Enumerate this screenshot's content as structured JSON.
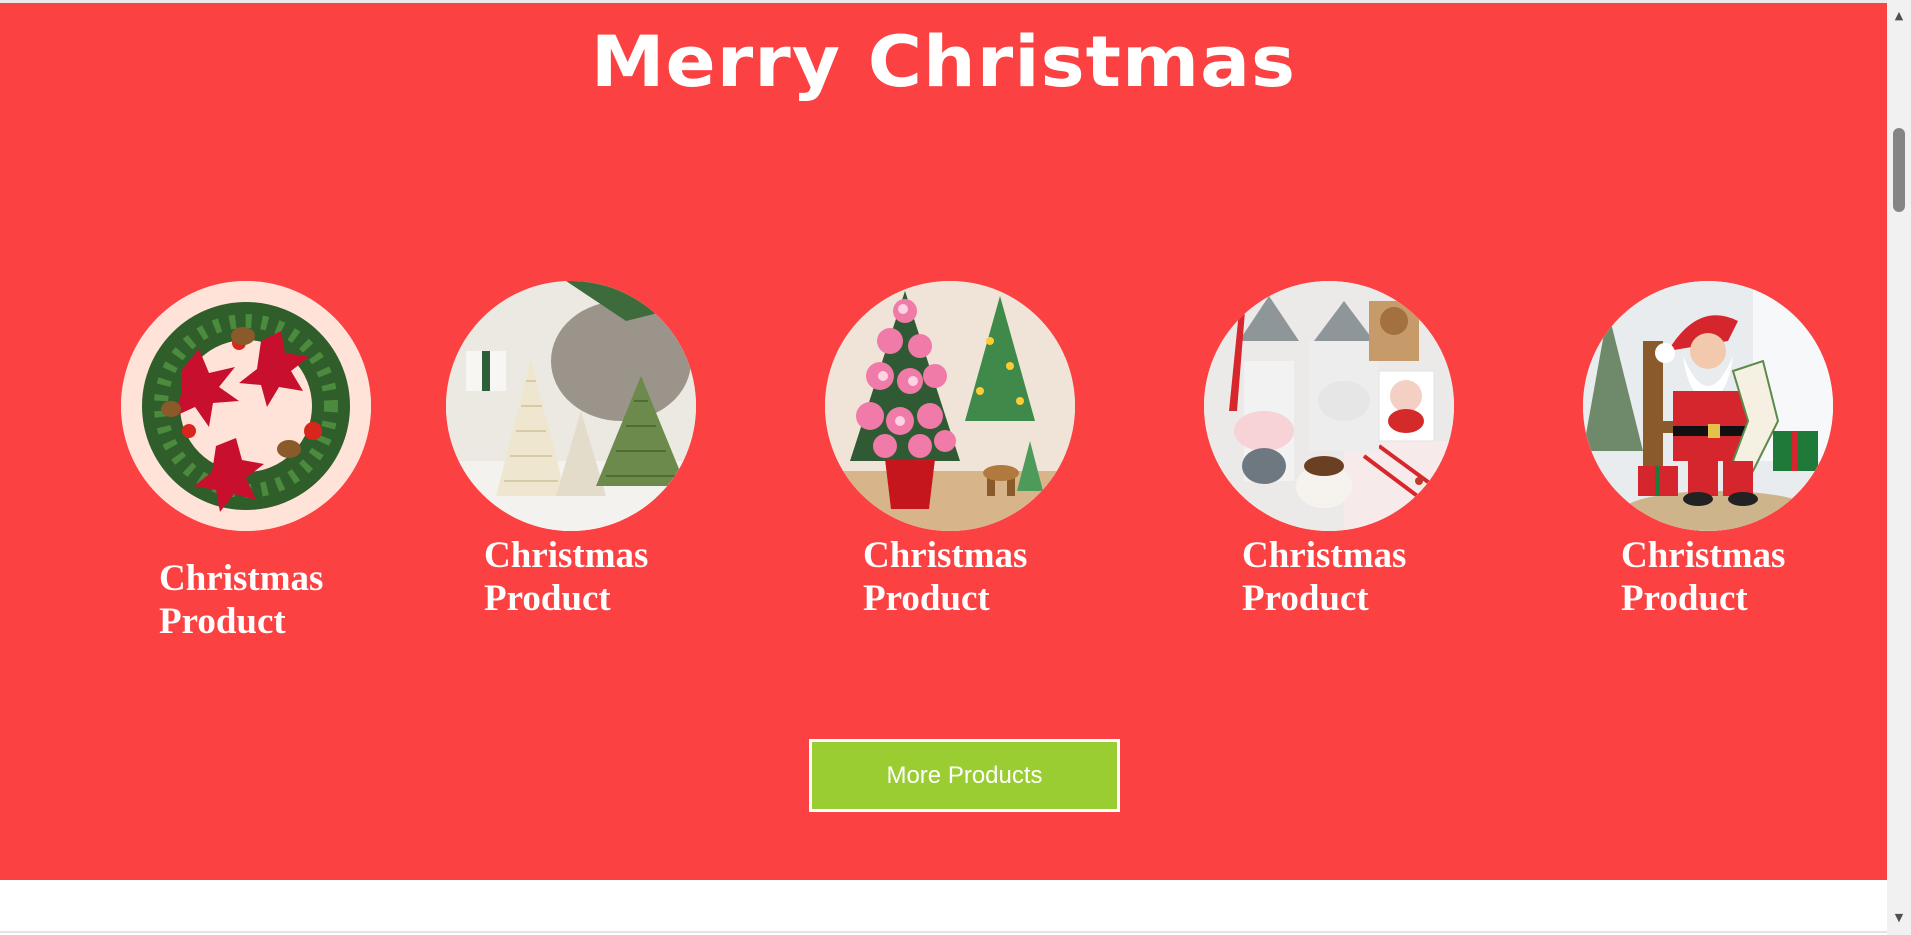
{
  "page": {
    "title": "Merry Christmas",
    "colors": {
      "banner": "#fb4141",
      "button": "#9acd32",
      "text": "#ffffff"
    }
  },
  "products": [
    {
      "label": "Christmas Product",
      "image": "poinsettia-wreath"
    },
    {
      "label": "Christmas Product",
      "image": "paper-honeycomb-trees"
    },
    {
      "label": "Christmas Product",
      "image": "pink-flower-tree"
    },
    {
      "label": "Christmas Product",
      "image": "gnome-santa-mugs"
    },
    {
      "label": "Christmas Product",
      "image": "santa-figurine"
    }
  ],
  "more_button": {
    "label": "More Products"
  },
  "scrollbar": {
    "up_icon": "scroll-up-arrow-icon",
    "down_icon": "scroll-down-arrow-icon"
  }
}
